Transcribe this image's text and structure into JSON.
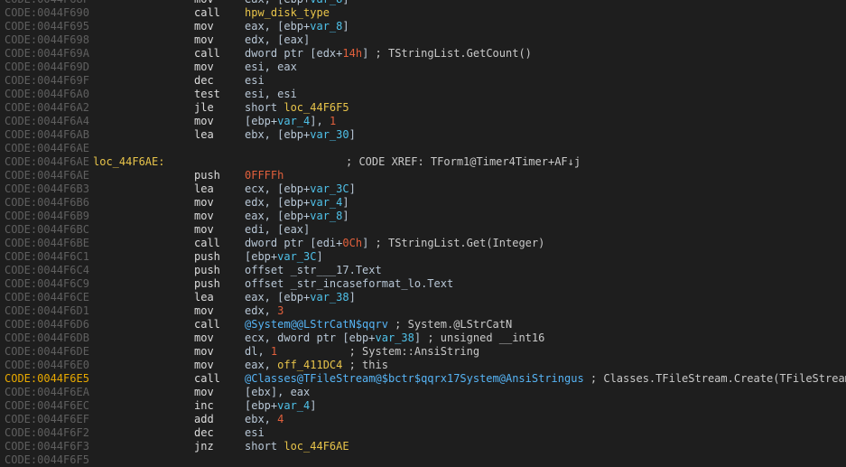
{
  "listing": {
    "lines": [
      {
        "addr": "CODE:0044F68F",
        "mnemonic": "mov",
        "operands": [
          {
            "t": "eax, [ebp+",
            "c": "plain"
          },
          {
            "t": "var_8",
            "c": "var"
          },
          {
            "t": "]",
            "c": "plain"
          }
        ]
      },
      {
        "addr": "CODE:0044F690",
        "mnemonic": "call",
        "operands": [
          {
            "t": "hpw_disk_type",
            "c": "name"
          }
        ]
      },
      {
        "addr": "CODE:0044F695",
        "mnemonic": "mov",
        "operands": [
          {
            "t": "eax, [ebp+",
            "c": "plain"
          },
          {
            "t": "var_8",
            "c": "var"
          },
          {
            "t": "]",
            "c": "plain"
          }
        ]
      },
      {
        "addr": "CODE:0044F698",
        "mnemonic": "mov",
        "operands": [
          {
            "t": "edx, [eax]",
            "c": "plain"
          }
        ]
      },
      {
        "addr": "CODE:0044F69A",
        "mnemonic": "call",
        "operands": [
          {
            "t": "dword ptr [edx+",
            "c": "plain"
          },
          {
            "t": "14h",
            "c": "num"
          },
          {
            "t": "] ",
            "c": "plain"
          },
          {
            "t": "; TStringList.GetCount()",
            "c": "cmt"
          }
        ]
      },
      {
        "addr": "CODE:0044F69D",
        "mnemonic": "mov",
        "operands": [
          {
            "t": "esi, eax",
            "c": "plain"
          }
        ]
      },
      {
        "addr": "CODE:0044F69F",
        "mnemonic": "dec",
        "operands": [
          {
            "t": "esi",
            "c": "plain"
          }
        ]
      },
      {
        "addr": "CODE:0044F6A0",
        "mnemonic": "test",
        "operands": [
          {
            "t": "esi, esi",
            "c": "plain"
          }
        ]
      },
      {
        "addr": "CODE:0044F6A2",
        "mnemonic": "jle",
        "operands": [
          {
            "t": "short ",
            "c": "plain"
          },
          {
            "t": "loc_44F6F5",
            "c": "name"
          }
        ]
      },
      {
        "addr": "CODE:0044F6A4",
        "mnemonic": "mov",
        "operands": [
          {
            "t": "[ebp+",
            "c": "plain"
          },
          {
            "t": "var_4",
            "c": "var"
          },
          {
            "t": "], ",
            "c": "plain"
          },
          {
            "t": "1",
            "c": "num"
          }
        ]
      },
      {
        "addr": "CODE:0044F6AB",
        "mnemonic": "lea",
        "operands": [
          {
            "t": "ebx, [ebp+",
            "c": "plain"
          },
          {
            "t": "var_30",
            "c": "var"
          },
          {
            "t": "]",
            "c": "plain"
          }
        ]
      },
      {
        "addr": "CODE:0044F6AE"
      },
      {
        "addr": "CODE:0044F6AE",
        "label": "loc_44F6AE:",
        "comment": "; CODE XREF: TForm1@Timer4Timer+AF↓j"
      },
      {
        "addr": "CODE:0044F6AE",
        "mnemonic": "push",
        "operands": [
          {
            "t": "0FFFFh",
            "c": "num"
          }
        ]
      },
      {
        "addr": "CODE:0044F6B3",
        "mnemonic": "lea",
        "operands": [
          {
            "t": "ecx, [ebp+",
            "c": "plain"
          },
          {
            "t": "var_3C",
            "c": "var"
          },
          {
            "t": "]",
            "c": "plain"
          }
        ]
      },
      {
        "addr": "CODE:0044F6B6",
        "mnemonic": "mov",
        "operands": [
          {
            "t": "edx, [ebp+",
            "c": "plain"
          },
          {
            "t": "var_4",
            "c": "var"
          },
          {
            "t": "]",
            "c": "plain"
          }
        ]
      },
      {
        "addr": "CODE:0044F6B9",
        "mnemonic": "mov",
        "operands": [
          {
            "t": "eax, [ebp+",
            "c": "plain"
          },
          {
            "t": "var_8",
            "c": "var"
          },
          {
            "t": "]",
            "c": "plain"
          }
        ]
      },
      {
        "addr": "CODE:0044F6BC",
        "mnemonic": "mov",
        "operands": [
          {
            "t": "edi, [eax]",
            "c": "plain"
          }
        ]
      },
      {
        "addr": "CODE:0044F6BE",
        "mnemonic": "call",
        "operands": [
          {
            "t": "dword ptr [edi+",
            "c": "plain"
          },
          {
            "t": "0Ch",
            "c": "num"
          },
          {
            "t": "] ",
            "c": "plain"
          },
          {
            "t": "; TStringList.Get(Integer)",
            "c": "cmt"
          }
        ]
      },
      {
        "addr": "CODE:0044F6C1",
        "mnemonic": "push",
        "operands": [
          {
            "t": "[ebp+",
            "c": "plain"
          },
          {
            "t": "var_3C",
            "c": "var"
          },
          {
            "t": "]",
            "c": "plain"
          }
        ]
      },
      {
        "addr": "CODE:0044F6C4",
        "mnemonic": "push",
        "operands": [
          {
            "t": "offset _str___17.Text",
            "c": "plain"
          }
        ]
      },
      {
        "addr": "CODE:0044F6C9",
        "mnemonic": "push",
        "operands": [
          {
            "t": "offset _str_incaseformat_lo.Text",
            "c": "plain"
          }
        ]
      },
      {
        "addr": "CODE:0044F6CE",
        "mnemonic": "lea",
        "operands": [
          {
            "t": "eax, [ebp+",
            "c": "plain"
          },
          {
            "t": "var_38",
            "c": "var"
          },
          {
            "t": "]",
            "c": "plain"
          }
        ]
      },
      {
        "addr": "CODE:0044F6D1",
        "mnemonic": "mov",
        "operands": [
          {
            "t": "edx, ",
            "c": "plain"
          },
          {
            "t": "3",
            "c": "num"
          }
        ]
      },
      {
        "addr": "CODE:0044F6D6",
        "mnemonic": "call",
        "operands": [
          {
            "t": "@System@@LStrCatN$qqrv",
            "c": "sym"
          },
          {
            "t": " ; System.@LStrCatN",
            "c": "cmt"
          }
        ]
      },
      {
        "addr": "CODE:0044F6DB",
        "mnemonic": "mov",
        "operands": [
          {
            "t": "ecx, dword ptr [ebp+",
            "c": "plain"
          },
          {
            "t": "var_38",
            "c": "var"
          },
          {
            "t": "] ",
            "c": "plain"
          },
          {
            "t": "; unsigned __int16",
            "c": "cmt"
          }
        ]
      },
      {
        "addr": "CODE:0044F6DE",
        "mnemonic": "mov",
        "operands": [
          {
            "t": "dl, ",
            "c": "plain"
          },
          {
            "t": "1",
            "c": "num"
          },
          {
            "t": "           ; System::AnsiString",
            "c": "cmt"
          }
        ]
      },
      {
        "addr": "CODE:0044F6E0",
        "mnemonic": "mov",
        "operands": [
          {
            "t": "eax, ",
            "c": "plain"
          },
          {
            "t": "off_411DC4",
            "c": "name"
          },
          {
            "t": " ; this",
            "c": "cmt"
          }
        ]
      },
      {
        "addr": "CODE:0044F6E5",
        "hl": true,
        "mnemonic": "call",
        "operands": [
          {
            "t": "@Classes@TFileStream@$bctr$qqrx17System@AnsiStringus",
            "c": "sym"
          },
          {
            "t": " ; Classes.TFileStream.Create(TFileStream",
            "c": "cmt"
          }
        ]
      },
      {
        "addr": "CODE:0044F6EA",
        "mnemonic": "mov",
        "operands": [
          {
            "t": "[ebx], eax",
            "c": "plain"
          }
        ]
      },
      {
        "addr": "CODE:0044F6EC",
        "mnemonic": "inc",
        "operands": [
          {
            "t": "[ebp+",
            "c": "plain"
          },
          {
            "t": "var_4",
            "c": "var"
          },
          {
            "t": "]",
            "c": "plain"
          }
        ]
      },
      {
        "addr": "CODE:0044F6EF",
        "mnemonic": "add",
        "operands": [
          {
            "t": "ebx, ",
            "c": "plain"
          },
          {
            "t": "4",
            "c": "num"
          }
        ]
      },
      {
        "addr": "CODE:0044F6F2",
        "mnemonic": "dec",
        "operands": [
          {
            "t": "esi",
            "c": "plain"
          }
        ]
      },
      {
        "addr": "CODE:0044F6F3",
        "mnemonic": "jnz",
        "operands": [
          {
            "t": "short ",
            "c": "plain"
          },
          {
            "t": "loc_44F6AE",
            "c": "name"
          }
        ]
      },
      {
        "addr": "CODE:0044F6F5"
      }
    ]
  }
}
